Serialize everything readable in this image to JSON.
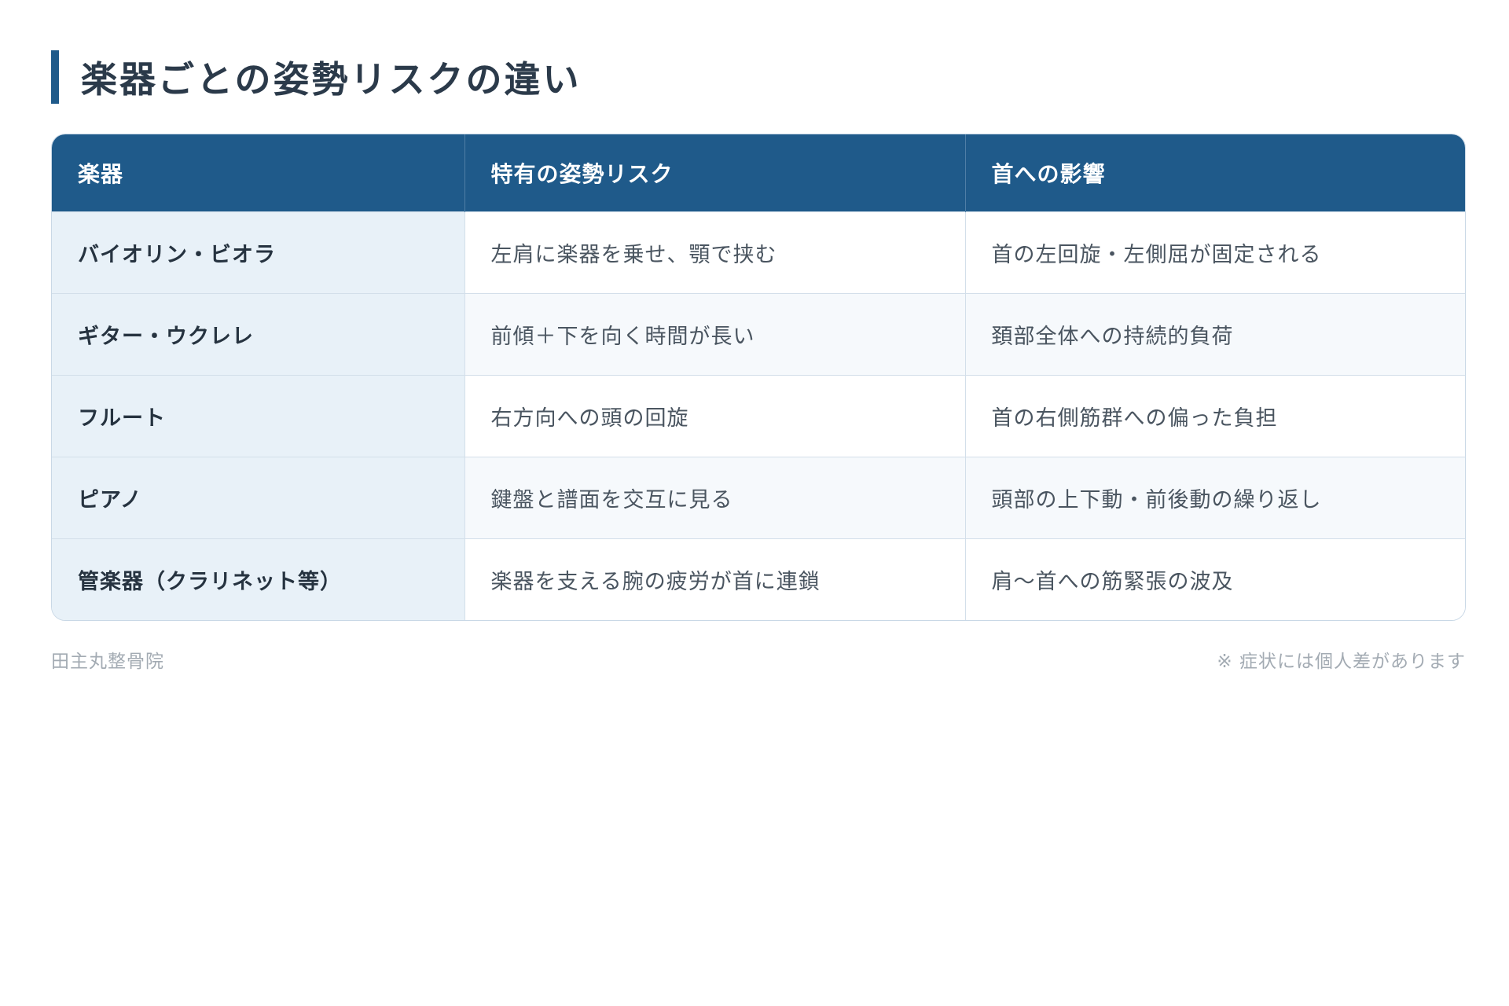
{
  "page": {
    "title": "楽器ごとの姿勢リスクの違い"
  },
  "table": {
    "headers": [
      "楽器",
      "特有の姿勢リスク",
      "首への影響"
    ],
    "rows": [
      [
        "バイオリン・ビオラ",
        "左肩に楽器を乗せ、顎で挟む",
        "首の左回旋・左側屈が固定される"
      ],
      [
        "ギター・ウクレレ",
        "前傾＋下を向く時間が長い",
        "頚部全体への持続的負荷"
      ],
      [
        "フルート",
        "右方向への頭の回旋",
        "首の右側筋群への偏った負担"
      ],
      [
        "ピアノ",
        "鍵盤と譜面を交互に見る",
        "頭部の上下動・前後動の繰り返し"
      ],
      [
        "管楽器（クラリネット等）",
        "楽器を支える腕の疲労が首に連鎖",
        "肩〜首への筋緊張の波及"
      ]
    ]
  },
  "footer": {
    "clinic": "田主丸整骨院",
    "note": "※ 症状には個人差があります"
  },
  "colors": {
    "accent": "#1f5a8a",
    "first_column_bg": "#e8f1f8"
  }
}
